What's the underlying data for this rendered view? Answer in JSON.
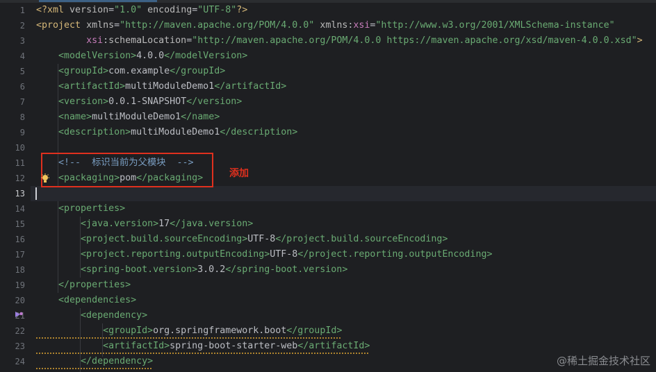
{
  "editor": {
    "language": "xml",
    "file_type": "pom.xml",
    "current_line": "13",
    "gutter": [
      "1",
      "2",
      "3",
      "4",
      "5",
      "6",
      "7",
      "8",
      "9",
      "10",
      "11",
      "12",
      "13",
      "14",
      "15",
      "16",
      "17",
      "18",
      "19",
      "20",
      "21",
      "22",
      "23",
      "24"
    ],
    "lines": [
      {
        "segs": [
          {
            "t": "pi",
            "v": "<?xml "
          },
          {
            "t": "attr",
            "v": "version"
          },
          {
            "t": "text",
            "v": "="
          },
          {
            "t": "str",
            "v": "\"1.0\" "
          },
          {
            "t": "attr",
            "v": "encoding"
          },
          {
            "t": "text",
            "v": "="
          },
          {
            "t": "str",
            "v": "\"UTF-8\""
          },
          {
            "t": "pi",
            "v": "?>"
          }
        ]
      },
      {
        "segs": [
          {
            "t": "tag",
            "v": "<project "
          },
          {
            "t": "attr",
            "v": "xmlns"
          },
          {
            "t": "text",
            "v": "="
          },
          {
            "t": "str",
            "v": "\"http://maven.apache.org/POM/4.0.0\" "
          },
          {
            "t": "attr",
            "v": "xmlns"
          },
          {
            "t": "text",
            "v": ":"
          },
          {
            "t": "ns",
            "v": "xsi"
          },
          {
            "t": "text",
            "v": "="
          },
          {
            "t": "str",
            "v": "\"http://www.w3.org/2001/XMLSchema-instance\""
          }
        ]
      },
      {
        "segs": [
          {
            "t": "text",
            "v": "         "
          },
          {
            "t": "ns",
            "v": "xsi"
          },
          {
            "t": "text",
            "v": ":"
          },
          {
            "t": "attr",
            "v": "schemaLocation"
          },
          {
            "t": "text",
            "v": "="
          },
          {
            "t": "str",
            "v": "\"http://maven.apache.org/POM/4.0.0 https://maven.apache.org/xsd/maven-4.0.0.xsd\""
          },
          {
            "t": "tag",
            "v": ">"
          }
        ]
      },
      {
        "segs": [
          {
            "t": "text",
            "v": "    "
          },
          {
            "t": "xmltag",
            "v": "<modelVersion>"
          },
          {
            "t": "text",
            "v": "4.0.0"
          },
          {
            "t": "xmltag",
            "v": "</modelVersion>"
          }
        ]
      },
      {
        "segs": [
          {
            "t": "text",
            "v": "    "
          },
          {
            "t": "xmltag",
            "v": "<groupId>"
          },
          {
            "t": "text",
            "v": "com.example"
          },
          {
            "t": "xmltag",
            "v": "</groupId>"
          }
        ]
      },
      {
        "segs": [
          {
            "t": "text",
            "v": "    "
          },
          {
            "t": "xmltag",
            "v": "<artifactId>"
          },
          {
            "t": "text",
            "v": "multiModuleDemo1"
          },
          {
            "t": "xmltag",
            "v": "</artifactId>"
          }
        ]
      },
      {
        "segs": [
          {
            "t": "text",
            "v": "    "
          },
          {
            "t": "xmltag",
            "v": "<version>"
          },
          {
            "t": "text",
            "v": "0.0.1-SNAPSHOT"
          },
          {
            "t": "xmltag",
            "v": "</version>"
          }
        ]
      },
      {
        "segs": [
          {
            "t": "text",
            "v": "    "
          },
          {
            "t": "xmltag",
            "v": "<name>"
          },
          {
            "t": "text",
            "v": "multiModuleDemo1"
          },
          {
            "t": "xmltag",
            "v": "</name>"
          }
        ]
      },
      {
        "segs": [
          {
            "t": "text",
            "v": "    "
          },
          {
            "t": "xmltag",
            "v": "<description>"
          },
          {
            "t": "text",
            "v": "multiModuleDemo1"
          },
          {
            "t": "xmltag",
            "v": "</description>"
          }
        ]
      },
      {
        "segs": []
      },
      {
        "segs": [
          {
            "t": "text",
            "v": "    "
          },
          {
            "t": "comment",
            "v": "<!--  标识当前为父模块  -->"
          }
        ]
      },
      {
        "segs": [
          {
            "t": "text",
            "v": "    "
          },
          {
            "t": "xmltag",
            "v": "<packaging>"
          },
          {
            "t": "text",
            "v": "pom"
          },
          {
            "t": "xmltag",
            "v": "</packaging>"
          }
        ]
      },
      {
        "segs": []
      },
      {
        "segs": [
          {
            "t": "text",
            "v": "    "
          },
          {
            "t": "xmltag",
            "v": "<properties>"
          }
        ]
      },
      {
        "segs": [
          {
            "t": "text",
            "v": "        "
          },
          {
            "t": "xmltag",
            "v": "<java.version>"
          },
          {
            "t": "text",
            "v": "17"
          },
          {
            "t": "xmltag",
            "v": "</java.version>"
          }
        ]
      },
      {
        "segs": [
          {
            "t": "text",
            "v": "        "
          },
          {
            "t": "xmltag",
            "v": "<project.build.sourceEncoding>"
          },
          {
            "t": "text",
            "v": "UTF-8"
          },
          {
            "t": "xmltag",
            "v": "</project.build.sourceEncoding>"
          }
        ]
      },
      {
        "segs": [
          {
            "t": "text",
            "v": "        "
          },
          {
            "t": "xmltag",
            "v": "<project.reporting.outputEncoding>"
          },
          {
            "t": "text",
            "v": "UTF-8"
          },
          {
            "t": "xmltag",
            "v": "</project.reporting.outputEncoding>"
          }
        ]
      },
      {
        "segs": [
          {
            "t": "text",
            "v": "        "
          },
          {
            "t": "xmltag",
            "v": "<spring-boot.version>"
          },
          {
            "t": "text",
            "v": "3.0.2"
          },
          {
            "t": "xmltag",
            "v": "</spring-boot.version>"
          }
        ]
      },
      {
        "segs": [
          {
            "t": "text",
            "v": "    "
          },
          {
            "t": "xmltag",
            "v": "</properties>"
          }
        ]
      },
      {
        "segs": [
          {
            "t": "text",
            "v": "    "
          },
          {
            "t": "xmltag",
            "v": "<dependencies>"
          }
        ]
      },
      {
        "segs": [
          {
            "t": "text",
            "v": "        "
          },
          {
            "t": "xmltag",
            "v": "<dependency>"
          }
        ]
      },
      {
        "segs": [
          {
            "t": "text",
            "v": "            "
          },
          {
            "t": "xmltag",
            "v": "<groupId>"
          },
          {
            "t": "text",
            "v": "org.springframework.boot"
          },
          {
            "t": "xmltag",
            "v": "</groupId>"
          }
        ]
      },
      {
        "segs": [
          {
            "t": "text",
            "v": "            "
          },
          {
            "t": "xmltag",
            "v": "<artifactId>"
          },
          {
            "t": "text",
            "v": "spring-boot-starter-web"
          },
          {
            "t": "xmltag",
            "v": "</artifactId>"
          }
        ]
      },
      {
        "segs": [
          {
            "t": "text",
            "v": "        "
          },
          {
            "t": "xmltag",
            "v": "</dependency>"
          }
        ]
      }
    ]
  },
  "annotation": {
    "label": "添加",
    "color": "#e0301e"
  },
  "icons": {
    "gutter_21": "dependency-run-icon",
    "line_12": "intention-bulb-icon"
  },
  "watermark": "@稀土掘金技术社区",
  "colors": {
    "background": "#1e1f22",
    "tag": "#6aab73",
    "string": "#6aab73",
    "comment": "#7a9ec2",
    "text": "#bcbec4",
    "attribute": "#bababa",
    "namespace": "#c77dbb"
  }
}
